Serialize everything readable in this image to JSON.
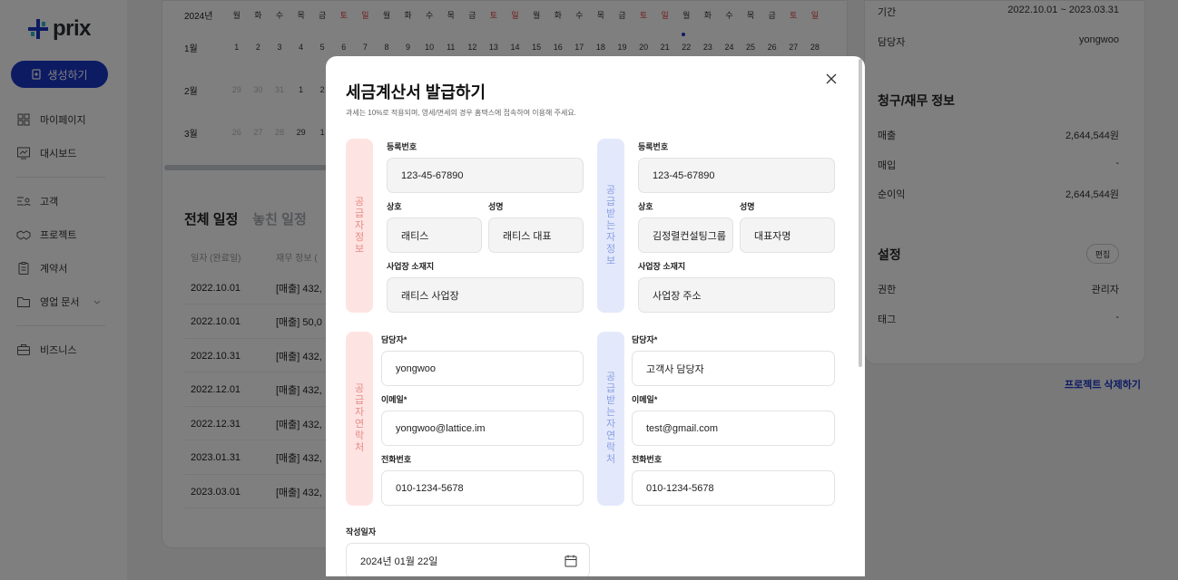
{
  "brand": {
    "name": "prix"
  },
  "sidebar": {
    "create_label": "생성하기",
    "items": [
      {
        "label": "마이페이지"
      },
      {
        "label": "대시보드"
      },
      {
        "label": "고객"
      },
      {
        "label": "프로젝트"
      },
      {
        "label": "계약서"
      },
      {
        "label": "영업 문서"
      },
      {
        "label": "비즈니스"
      }
    ]
  },
  "calendar": {
    "header_label": "2024년",
    "weekdays": [
      "월",
      "화",
      "수",
      "목",
      "금",
      "토",
      "일",
      "월",
      "화",
      "수",
      "목",
      "금",
      "토",
      "일",
      "월",
      "화",
      "수",
      "목",
      "금",
      "토",
      "일",
      "월",
      "화",
      "수",
      "목",
      "금",
      "토",
      "일"
    ],
    "months": [
      {
        "label": "1월",
        "days": [
          "1",
          "2",
          "3",
          "4",
          "5",
          "6",
          "7",
          "8",
          "9",
          "10",
          "11",
          "12",
          "13",
          "14",
          "15",
          "16",
          "17",
          "18",
          "19",
          "20",
          "21",
          "22",
          "23",
          "24",
          "25",
          "26",
          "27",
          "28"
        ]
      },
      {
        "label": "2월",
        "days": [
          "29",
          "30",
          "31",
          "1",
          "2"
        ]
      },
      {
        "label": "3월",
        "days": [
          "26",
          "27",
          "28",
          "29",
          "1"
        ]
      }
    ]
  },
  "schedule": {
    "tab_all": "전체 일정",
    "tab_missed": "놓친 일정",
    "col_date": "일자 (완료일)",
    "col_finance": "재무 정보 (",
    "rows": [
      {
        "date": "2022.10.01",
        "finance": "[매출] 432,"
      },
      {
        "date": "2022.10.01",
        "finance": "[매출] 50,0"
      },
      {
        "date": "2022.10.31",
        "finance": "[매출] 432,"
      },
      {
        "date": "2022.12.01",
        "finance": "[매출] 432,"
      },
      {
        "date": "2022.12.31",
        "finance": "[매출] 432,"
      },
      {
        "date": "2023.01.31",
        "finance": "[매출] 432,"
      },
      {
        "date": "2023.03.01",
        "finance": "[매출] 432,"
      }
    ]
  },
  "project_info": {
    "period_label": "기간",
    "period_value": "2022.10.01 ~ 2023.03.31",
    "manager_label": "담당자",
    "manager_value": "yongwoo",
    "billing_title": "청구/재무 정보",
    "sales_label": "매출",
    "sales_value": "2,644,544원",
    "purchase_label": "매입",
    "purchase_value": "-",
    "profit_label": "순이익",
    "profit_value": "2,644,544원",
    "settings_title": "설정",
    "edit_label": "편집",
    "permission_label": "권한",
    "permission_value": "관리자",
    "tag_label": "태그",
    "tag_value": "-",
    "delete_label": "프로젝트 삭제하기"
  },
  "modal": {
    "title": "세금계산서 발급하기",
    "subtitle": "과세는 10%로 적용되며, 영세/면세의 경우 홈택스에 접속하여 이용해 주세요.",
    "supplier_info_tag": [
      "공",
      "급",
      "자",
      "정",
      "보"
    ],
    "receiver_info_tag": [
      "공",
      "급",
      "받",
      "는",
      "자",
      "정",
      "보"
    ],
    "supplier_contact_tag": [
      "공",
      "급",
      "자",
      "연",
      "락",
      "처"
    ],
    "receiver_contact_tag": [
      "공",
      "급",
      "받",
      "는",
      "자",
      "연",
      "락",
      "처"
    ],
    "supplier": {
      "reg_label": "등록번호",
      "reg_value": "123-45-67890",
      "company_label": "상호",
      "company_value": "래티스",
      "name_label": "성명",
      "name_value": "래티스 대표",
      "address_label": "사업장 소재지",
      "address_value": "래티스 사업장",
      "contact_label": "담당자*",
      "contact_value": "yongwoo",
      "email_label": "이메일*",
      "email_value": "yongwoo@lattice.im",
      "phone_label": "전화번호",
      "phone_value": "010-1234-5678"
    },
    "receiver": {
      "reg_label": "등록번호",
      "reg_value": "123-45-67890",
      "company_label": "상호",
      "company_value": "김정렬컨설팅그룹",
      "name_label": "성명",
      "name_value": "대표자명",
      "address_label": "사업장 소재지",
      "address_value": "사업장 주소",
      "contact_label": "담당자*",
      "contact_value": "고객사 담당자",
      "email_label": "이메일*",
      "email_value": "test@gmail.com",
      "phone_label": "전화번호",
      "phone_value": "010-1234-5678"
    },
    "date_label": "작성일자",
    "date_value": "2024년 01월 22일"
  },
  "colors": {
    "accent": "#1a37c6",
    "weekend": "#e23b3b",
    "supplier_tag": "#fde4e2",
    "receiver_tag": "#e3e9fb"
  }
}
